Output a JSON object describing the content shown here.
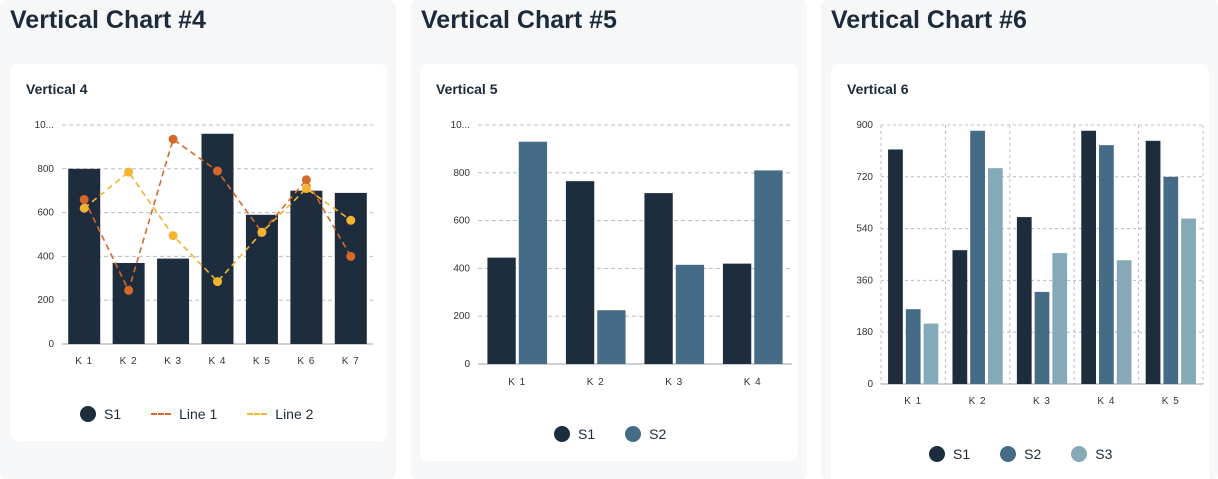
{
  "panels": [
    {
      "title": "Vertical Chart #4",
      "card_title": "Vertical 4"
    },
    {
      "title": "Vertical Chart #5",
      "card_title": "Vertical 5"
    },
    {
      "title": "Vertical Chart #6",
      "card_title": "Vertical 6"
    }
  ],
  "legends": {
    "chart4": [
      {
        "label": "S1",
        "kind": "dot",
        "color": "#1e2d3d"
      },
      {
        "label": "Line 1",
        "kind": "dash",
        "color": "#d4692a"
      },
      {
        "label": "Line 2",
        "kind": "dash",
        "color": "#f2b531"
      }
    ],
    "chart5": [
      {
        "label": "S1",
        "kind": "dot",
        "color": "#1e2d3d"
      },
      {
        "label": "S2",
        "kind": "dot",
        "color": "#466b86"
      }
    ],
    "chart6": [
      {
        "label": "S1",
        "kind": "dot",
        "color": "#1e2d3d"
      },
      {
        "label": "S2",
        "kind": "dot",
        "color": "#466b86"
      },
      {
        "label": "S3",
        "kind": "dot",
        "color": "#86a9b7"
      }
    ]
  },
  "chart_data": [
    {
      "type": "bar",
      "title": "Vertical 4",
      "categories": [
        "K1",
        "K2",
        "K3",
        "K4",
        "K5",
        "K6",
        "K7"
      ],
      "ylim": [
        0,
        1000
      ],
      "yticks": [
        0,
        200,
        400,
        600,
        800,
        1000
      ],
      "ytick_labels": [
        "0",
        "200",
        "400",
        "600",
        "800",
        "10..."
      ],
      "grid": true,
      "legend_position": "bottom",
      "series": [
        {
          "name": "S1",
          "type": "bar",
          "color": "#1e2d3d",
          "values": [
            800,
            370,
            390,
            960,
            590,
            700,
            690
          ]
        },
        {
          "name": "Line 1",
          "type": "line",
          "color": "#d4692a",
          "values": [
            660,
            245,
            935,
            790,
            510,
            750,
            400
          ]
        },
        {
          "name": "Line 2",
          "type": "line",
          "color": "#f2b531",
          "values": [
            620,
            785,
            495,
            285,
            510,
            710,
            565
          ]
        }
      ]
    },
    {
      "type": "bar",
      "title": "Vertical 5",
      "categories": [
        "K1",
        "K2",
        "K3",
        "K4"
      ],
      "ylim": [
        0,
        1000
      ],
      "yticks": [
        0,
        200,
        400,
        600,
        800,
        1000
      ],
      "ytick_labels": [
        "0",
        "200",
        "400",
        "600",
        "800",
        "10..."
      ],
      "grid": true,
      "legend_position": "bottom",
      "series": [
        {
          "name": "S1",
          "color": "#1e2d3d",
          "values": [
            445,
            765,
            715,
            420
          ]
        },
        {
          "name": "S2",
          "color": "#466b86",
          "values": [
            930,
            225,
            415,
            810
          ]
        }
      ]
    },
    {
      "type": "bar",
      "title": "Vertical 6",
      "categories": [
        "K1",
        "K2",
        "K3",
        "K4",
        "K5"
      ],
      "ylim": [
        0,
        900
      ],
      "yticks": [
        0,
        180,
        360,
        540,
        720,
        900
      ],
      "ytick_labels": [
        "0",
        "180",
        "360",
        "540",
        "720",
        "900"
      ],
      "grid": true,
      "legend_position": "bottom",
      "series": [
        {
          "name": "S1",
          "color": "#1e2d3d",
          "values": [
            815,
            465,
            580,
            880,
            845
          ]
        },
        {
          "name": "S2",
          "color": "#466b86",
          "values": [
            260,
            880,
            320,
            830,
            720
          ]
        },
        {
          "name": "S3",
          "color": "#86a9b7",
          "values": [
            210,
            750,
            455,
            430,
            575
          ]
        }
      ]
    }
  ]
}
